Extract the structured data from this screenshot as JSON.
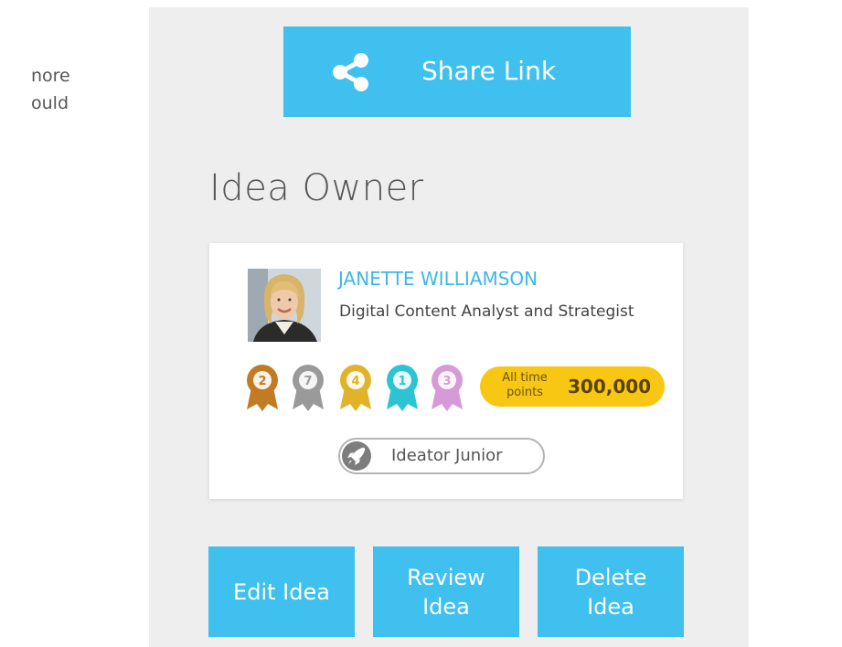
{
  "left_pane": {
    "text_line_1": "nore",
    "text_line_2": "ould"
  },
  "share": {
    "label": "Share Link",
    "icon": "share-icon"
  },
  "owner_section": {
    "title": "Idea Owner",
    "owner": {
      "name": "JANETTE WILLIAMSON",
      "role": "Digital Content Analyst and Strategist",
      "badges": [
        {
          "count": "2",
          "color": "#c27a23"
        },
        {
          "count": "7",
          "color": "#9a9a9a"
        },
        {
          "count": "4",
          "color": "#e0b32a"
        },
        {
          "count": "1",
          "color": "#2cc4d3"
        },
        {
          "count": "3",
          "color": "#d79ad8"
        }
      ],
      "points_caption": "All time points",
      "points_value": "300,000",
      "level": "Ideator Junior",
      "level_icon": "rocket-icon"
    }
  },
  "actions": {
    "edit_label": "Edit Idea",
    "review_label": "Review Idea",
    "delete_label": "Delete Idea"
  },
  "colors": {
    "accent": "#3fc0ee",
    "name_link": "#3fb6e8",
    "points_bg": "#f7c713",
    "sidebar_bg": "#eeeeee"
  }
}
